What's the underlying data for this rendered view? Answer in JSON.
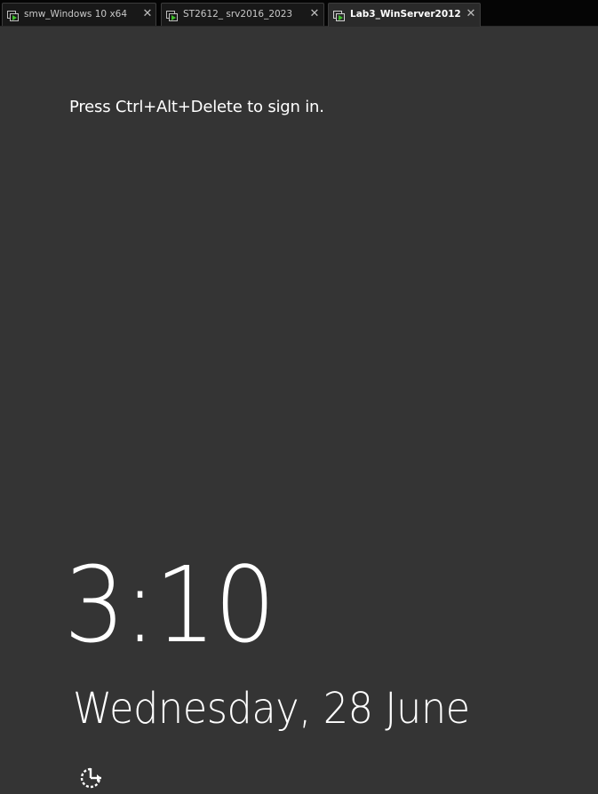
{
  "tabs": [
    {
      "label": "smw_Windows 10 x64",
      "icon": "vm-icon",
      "close": "✕",
      "active": false
    },
    {
      "label": "ST2612_ srv2016_2023",
      "icon": "vm-icon",
      "close": "✕",
      "active": false
    },
    {
      "label": "Lab3_WinServer2012",
      "icon": "vm-icon",
      "close": "✕",
      "active": true
    }
  ],
  "lock_screen": {
    "prompt": "Press Ctrl+Alt+Delete to sign in.",
    "time": "3:10",
    "date": "Wednesday, 28 June",
    "ease_of_access_icon": "ease-of-access-icon"
  },
  "colors": {
    "background": "#343434",
    "tabbar": "#050505",
    "vm_icon_green": "#3fbf2c",
    "text": "#ffffff"
  }
}
